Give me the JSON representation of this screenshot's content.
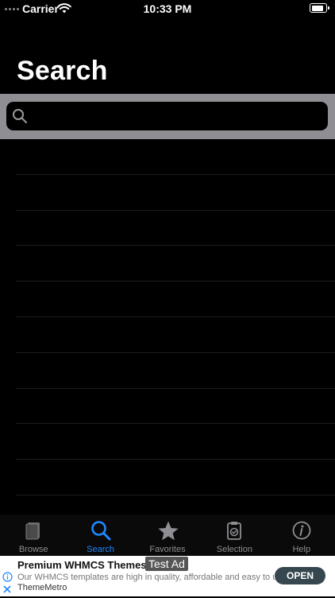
{
  "status_bar": {
    "carrier": "Carrier",
    "time": "10:33 PM"
  },
  "page": {
    "title": "Search"
  },
  "search": {
    "placeholder": "",
    "value": ""
  },
  "results": {
    "rows": [
      "",
      "",
      "",
      "",
      "",
      "",
      "",
      "",
      "",
      ""
    ]
  },
  "tab_bar": {
    "tabs": [
      {
        "label": "Browse",
        "icon": "book-icon",
        "active": false
      },
      {
        "label": "Search",
        "icon": "search-icon",
        "active": true
      },
      {
        "label": "Favorites",
        "icon": "star-icon",
        "active": false
      },
      {
        "label": "Selection",
        "icon": "clipboard-check-icon",
        "active": false
      },
      {
        "label": "Help",
        "icon": "info-icon",
        "active": false
      }
    ]
  },
  "ad": {
    "badge": "Test Ad",
    "title": "Premium WHMCS Themes",
    "description": "Our WHMCS templates are high in quality, affordable and easy to use.",
    "advertiser": "ThemeMetro",
    "cta": "OPEN"
  },
  "colors": {
    "background": "#000000",
    "accent": "#1e88ff",
    "inactive_tab": "#8e8e93",
    "search_bar_bg": "#8e8e93"
  }
}
